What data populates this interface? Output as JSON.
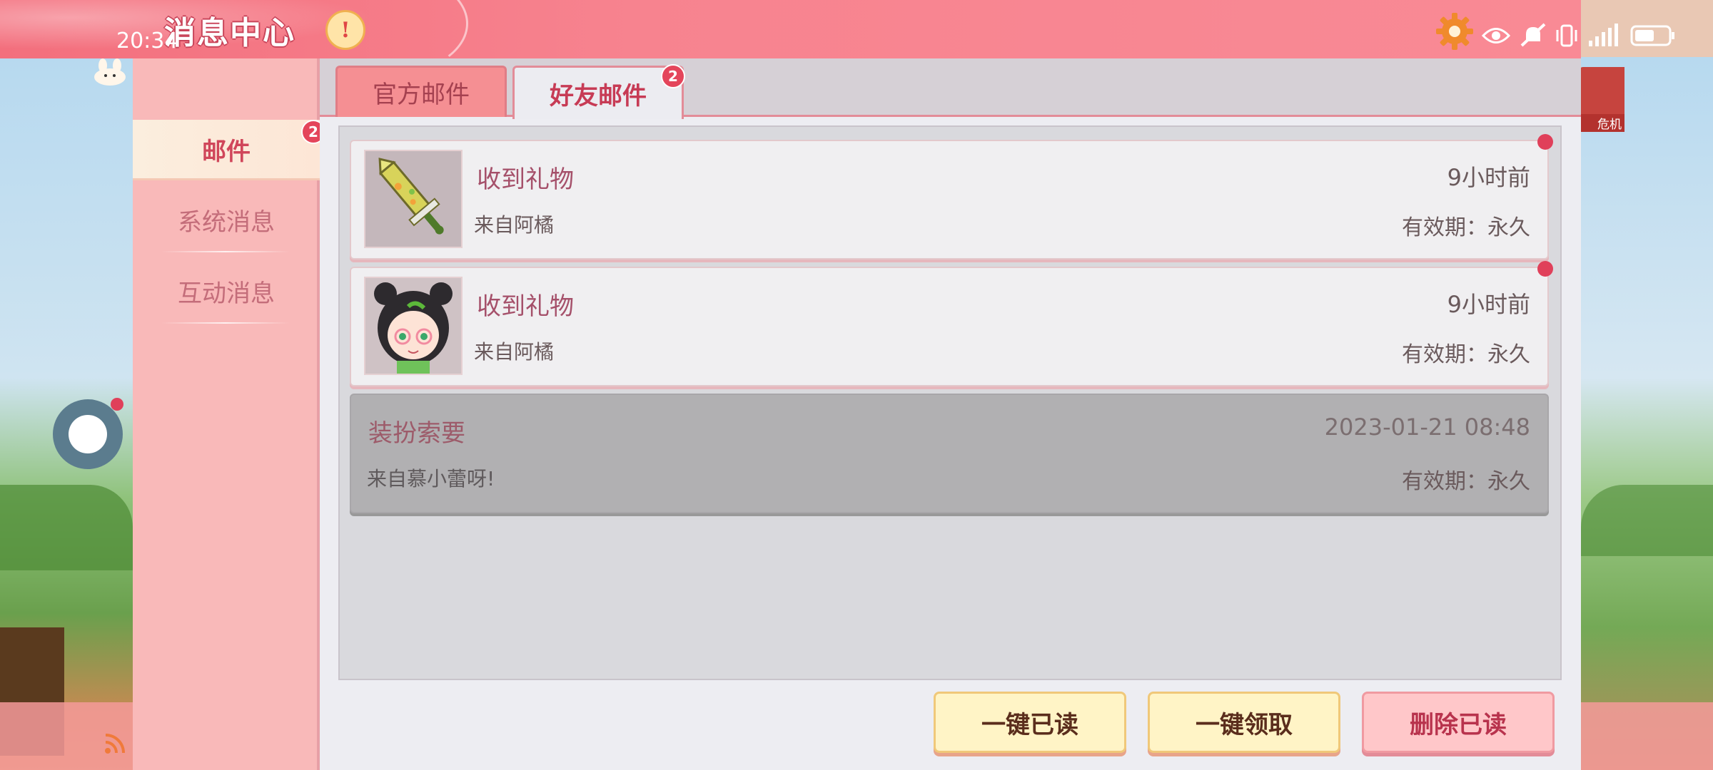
{
  "status_bar": {
    "time": "20:34",
    "icons": [
      "eye-icon",
      "bell-mute-icon",
      "vibrate-icon",
      "signal-icon",
      "battery-icon"
    ]
  },
  "header": {
    "title": "消息中心",
    "notice_glyph": "!",
    "settings_icon": "gear-icon"
  },
  "sidebar": {
    "items": [
      {
        "label": "邮件",
        "active": true,
        "badge": "2"
      },
      {
        "label": "系统消息",
        "active": false
      },
      {
        "label": "互动消息",
        "active": false
      }
    ]
  },
  "tabs": [
    {
      "label": "官方邮件",
      "active": false
    },
    {
      "label": "好友邮件",
      "active": true,
      "badge": "2"
    }
  ],
  "mails": [
    {
      "title": "收到礼物",
      "from": "来自阿橘",
      "time": "9小时前",
      "expire": "有效期：永久",
      "unread": true,
      "thumb": "sword-item-icon"
    },
    {
      "title": "收到礼物",
      "from": "来自阿橘",
      "time": "9小时前",
      "expire": "有效期：永久",
      "unread": true,
      "thumb": "girl-avatar"
    },
    {
      "title": "装扮索要",
      "from": "来自慕小蕾呀!",
      "time": "2023-01-21 08:48",
      "expire": "有效期：永久",
      "unread": false
    }
  ],
  "actions": {
    "read_all": "一键已读",
    "claim_all": "一键领取",
    "delete_read": "删除已读"
  },
  "right_badge_label": "危机",
  "colors": {
    "header": "#f7838f",
    "sidebar": "#f9b9b9",
    "accent": "#e4455b",
    "button_yellow": "#fff4c6",
    "button_pink": "#ffc7c9"
  }
}
